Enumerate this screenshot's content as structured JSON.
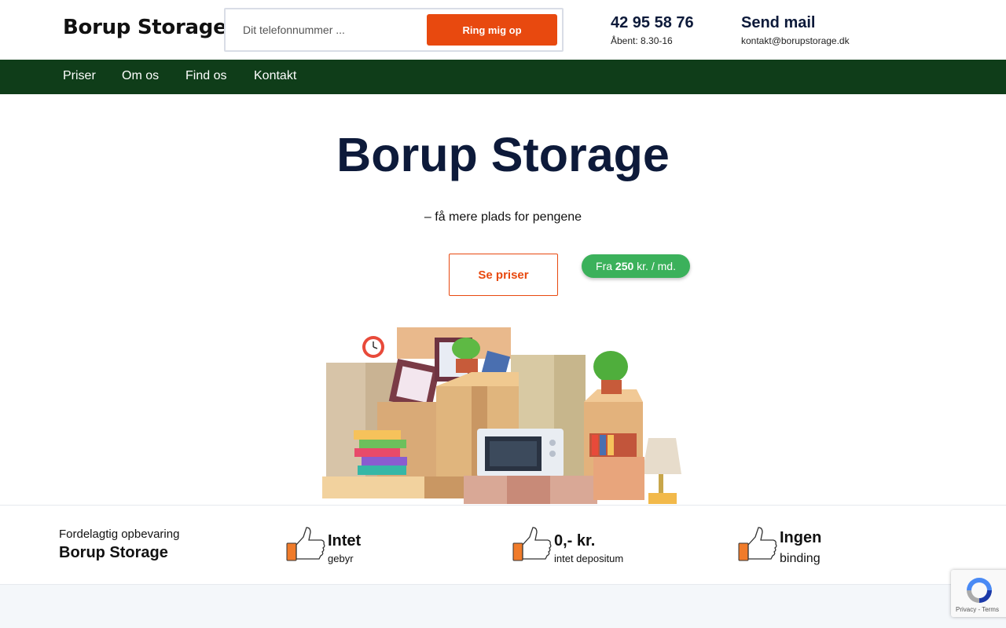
{
  "header": {
    "logo": "Borup Storage",
    "phone_placeholder": "Dit telefonnummer ...",
    "call_button": "Ring mig op",
    "phone": "42 95 58 76",
    "hours": "Åbent: 8.30-16",
    "mail_title": "Send mail",
    "mail_address": "kontakt@borupstorage.dk"
  },
  "nav": {
    "items": [
      {
        "label": "Priser"
      },
      {
        "label": "Om os"
      },
      {
        "label": "Find os"
      },
      {
        "label": "Kontakt"
      }
    ]
  },
  "hero": {
    "title": "Borup Storage",
    "subtitle": "– få mere plads for pengene",
    "cta": "Se priser",
    "price_prefix": "Fra",
    "price_value": "250",
    "price_suffix": "kr. / md."
  },
  "features": {
    "lead_small": "Fordelagtig opbevaring",
    "lead_big": "Borup Storage",
    "items": [
      {
        "title": "Intet",
        "desc": "gebyr"
      },
      {
        "title": "0,- kr.",
        "desc": "intet depositum"
      },
      {
        "title": "Ingen",
        "desc": "binding"
      }
    ]
  },
  "recaptcha": {
    "links": "Privacy - Terms"
  },
  "colors": {
    "accent": "#e8490f",
    "nav_bg": "#0f3d19",
    "badge": "#3bb15b",
    "title": "#0d1a3a"
  }
}
